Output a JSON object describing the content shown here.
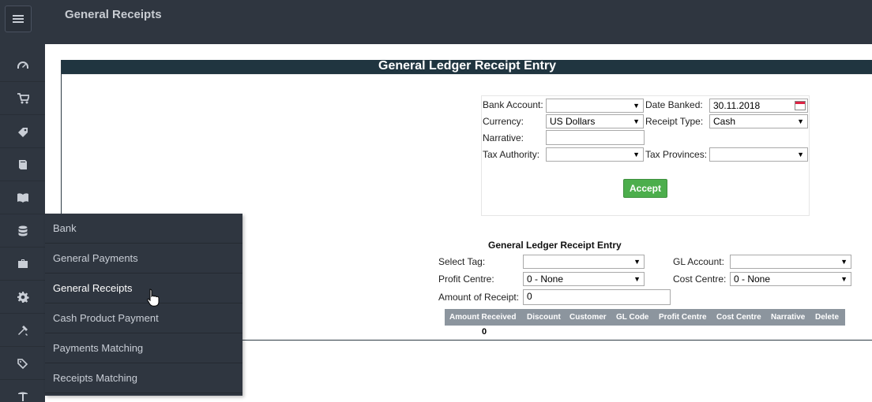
{
  "header": {
    "title": "General Receipts"
  },
  "icons": {
    "menu": "hamburger-menu-icon",
    "sidebar": [
      "dashboard-gauge-icon",
      "cart-icon",
      "tag-icon",
      "book-icon",
      "open-book-icon",
      "database-icon",
      "briefcase-icon",
      "gear-icon",
      "tools-icon",
      "tags-icon",
      "pickaxe-icon"
    ]
  },
  "flyout": {
    "items": [
      {
        "label": "Bank"
      },
      {
        "label": "General Payments"
      },
      {
        "label": "General Receipts"
      },
      {
        "label": "Cash Product Payment"
      },
      {
        "label": "Payments Matching"
      },
      {
        "label": "Receipts Matching"
      }
    ]
  },
  "content": {
    "title": "General Ledger Receipt Entry",
    "form": {
      "bank_account_label": "Bank Account:",
      "bank_account_value": "",
      "date_banked_label": "Date Banked:",
      "date_banked_value": "30.11.2018",
      "currency_label": "Currency:",
      "currency_value": "US Dollars",
      "receipt_type_label": "Receipt Type:",
      "receipt_type_value": "Cash",
      "narrative_label": "Narrative:",
      "narrative_value": "",
      "tax_authority_label": "Tax Authority:",
      "tax_authority_value": "",
      "tax_provinces_label": "Tax Provinces:",
      "tax_provinces_value": "",
      "accept_label": "Accept"
    },
    "entry": {
      "title": "General Ledger Receipt Entry",
      "select_tag_label": "Select Tag:",
      "select_tag_value": "",
      "gl_account_label": "GL Account:",
      "gl_account_value": "",
      "profit_centre_label": "Profit Centre:",
      "profit_centre_value": "0 - None",
      "cost_centre_label": "Cost Centre:",
      "cost_centre_value": "0 - None",
      "amount_label": "Amount of Receipt:",
      "amount_value": "0"
    },
    "table": {
      "columns": [
        "Amount Received",
        "Discount",
        "Customer",
        "GL Code",
        "Profit Centre",
        "Cost Centre",
        "Narrative",
        "Delete"
      ],
      "total": "0"
    }
  },
  "colors": {
    "topbar": "#2f3640",
    "content_header": "#203540",
    "accept_button": "#4cae4c",
    "table_header": "#8c959e"
  }
}
